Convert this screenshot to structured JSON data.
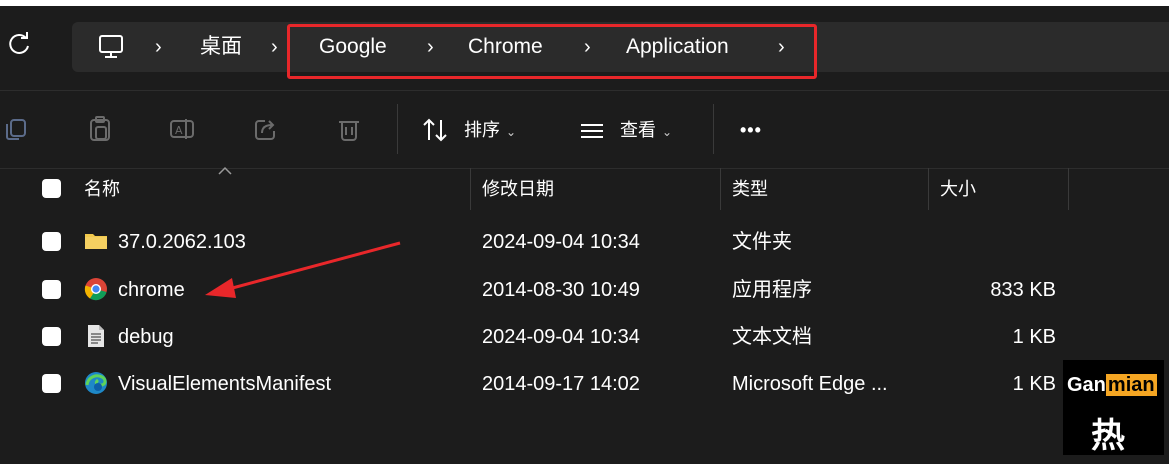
{
  "address_bar": {
    "crumbs": [
      "桌面",
      "Google",
      "Chrome",
      "Application"
    ],
    "separator": "›"
  },
  "toolbar": {
    "sort_label": "排序",
    "view_label": "查看",
    "more_label": "•••",
    "chevron": "⌄"
  },
  "columns": {
    "name": "名称",
    "modified": "修改日期",
    "type": "类型",
    "size": "大小"
  },
  "files": [
    {
      "name": "37.0.2062.103",
      "modified": "2024-09-04 10:34",
      "type": "文件夹",
      "size": "",
      "icon": "folder-icon"
    },
    {
      "name": "chrome",
      "modified": "2014-08-30 10:49",
      "type": "应用程序",
      "size": "833 KB",
      "icon": "chrome-icon"
    },
    {
      "name": "debug",
      "modified": "2024-09-04 10:34",
      "type": "文本文档",
      "size": "1 KB",
      "icon": "text-document-icon"
    },
    {
      "name": "VisualElementsManifest",
      "modified": "2014-09-17 14:02",
      "type": "Microsoft Edge ...",
      "size": "1 KB",
      "icon": "edge-icon"
    }
  ],
  "watermark": {
    "part1": "Gan",
    "part2": "mian",
    "glyph": "热"
  },
  "colors": {
    "highlight": "#e8272a",
    "folder": "#f2c94c",
    "background": "#1c1c1c"
  }
}
